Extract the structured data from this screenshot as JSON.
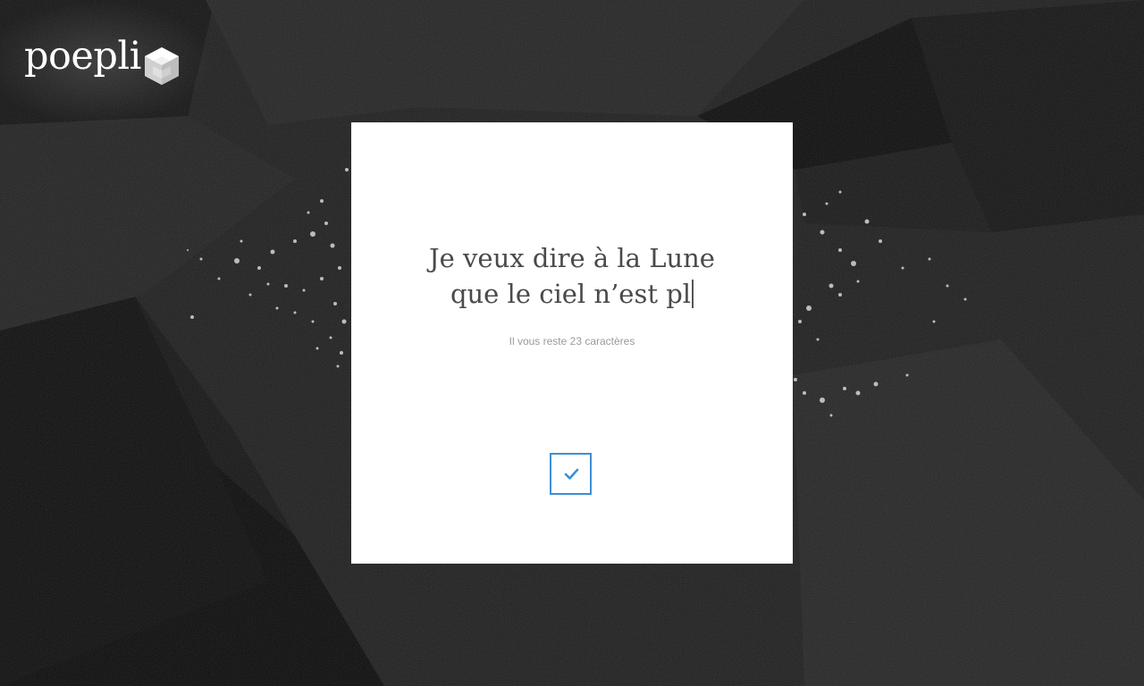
{
  "brand": {
    "name": "poepli",
    "icon": "cube-logo-icon"
  },
  "editor": {
    "line1": "Je veux dire à la Lune",
    "line2": "que le ciel n’est pl",
    "remaining_text": "Il vous reste 23 caractères"
  },
  "actions": {
    "confirm_icon": "checkmark-icon",
    "accent_color": "#3d8fd6"
  }
}
